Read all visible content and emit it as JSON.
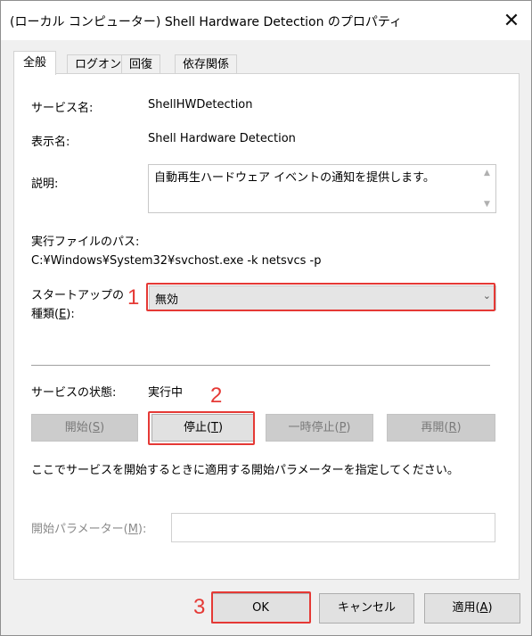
{
  "window": {
    "title": "(ローカル コンピューター) Shell Hardware Detection のプロパティ",
    "close_glyph": "✕"
  },
  "tabs": [
    {
      "label": "全般",
      "active": true
    },
    {
      "label": "ログオン",
      "active": false
    },
    {
      "label": "回復",
      "active": false
    },
    {
      "label": "依存関係",
      "active": false
    }
  ],
  "general": {
    "service_name_label": "サービス名:",
    "service_name_value": "ShellHWDetection",
    "display_name_label": "表示名:",
    "display_name_value": "Shell Hardware Detection",
    "description_label": "説明:",
    "description_value": "自動再生ハードウェア イベントの通知を提供します。",
    "exe_path_label": "実行ファイルのパス:",
    "exe_path_value": "C:¥Windows¥System32¥svchost.exe -k netsvcs -p",
    "startup_type_label_line1": "スタートアップの",
    "startup_type_label_line2_pre": "種類(",
    "startup_type_label_line2_key": "E",
    "startup_type_label_line2_post": "):",
    "startup_type_value": "無効",
    "status_label": "サービスの状態:",
    "status_value": "実行中",
    "buttons": {
      "start_pre": "開始(",
      "start_key": "S",
      "start_post": ")",
      "stop_pre": "停止(",
      "stop_key": "T",
      "stop_post": ")",
      "pause_pre": "一時停止(",
      "pause_key": "P",
      "pause_post": ")",
      "resume_pre": "再開(",
      "resume_key": "R",
      "resume_post": ")"
    },
    "hint_text": "ここでサービスを開始するときに適用する開始パラメーターを指定してください。",
    "params_label_pre": "開始パラメーター(",
    "params_label_key": "M",
    "params_label_post": "):",
    "params_value": ""
  },
  "footer": {
    "ok_label": "OK",
    "cancel_label": "キャンセル",
    "apply_pre": "適用(",
    "apply_key": "A",
    "apply_post": ")"
  },
  "annotations": {
    "marker_1": "1",
    "marker_2": "2",
    "marker_3": "3",
    "highlight_color": "#e53935"
  }
}
